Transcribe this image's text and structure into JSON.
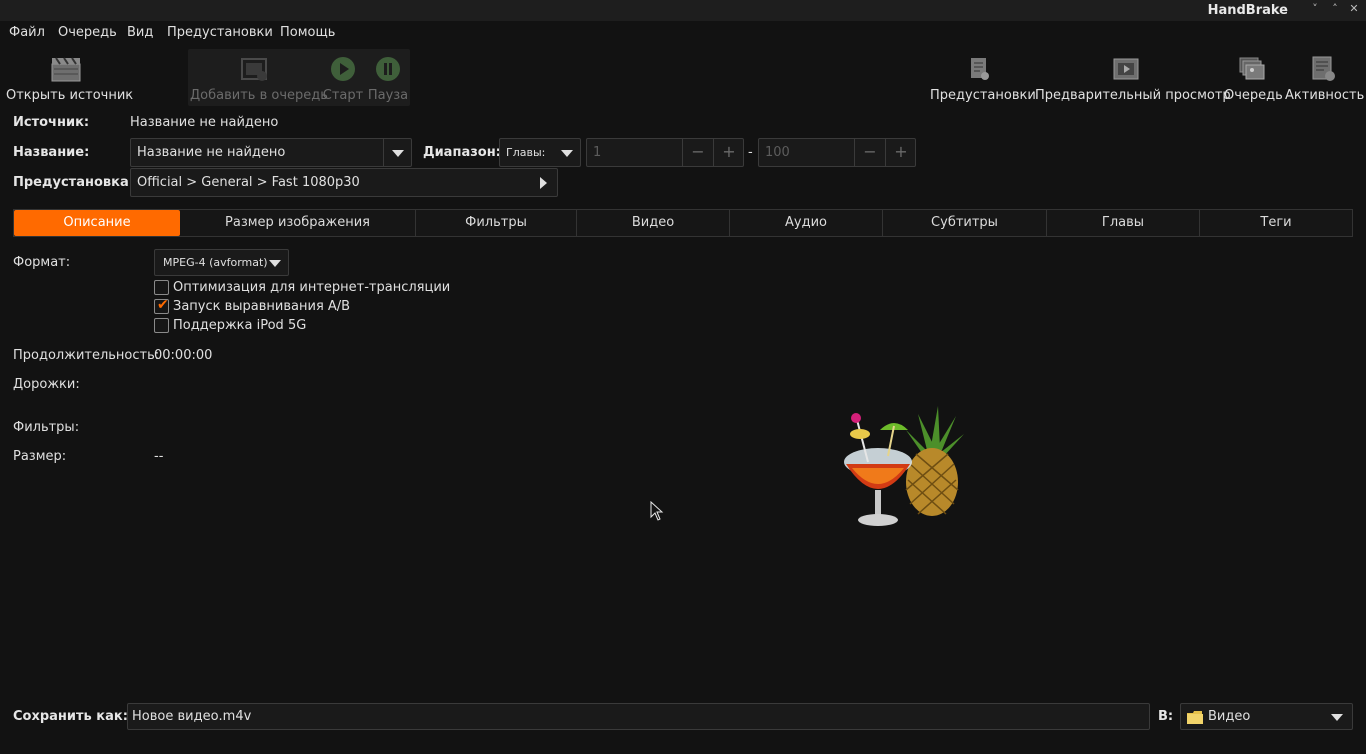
{
  "window": {
    "title": "HandBrake"
  },
  "menu": [
    "Файл",
    "Очередь",
    "Вид",
    "Предустановки",
    "Помощь"
  ],
  "toolbar": {
    "open_source": "Открыть источник",
    "add_to_queue": "Добавить в очередь",
    "start": "Старт",
    "pause": "Пауза",
    "presets": "Предустановки",
    "preview": "Предварительный просмотр",
    "queue": "Очередь",
    "activity": "Активность"
  },
  "source": {
    "label": "Источник:",
    "value": "Название не найдено"
  },
  "title_row": {
    "label": "Название:",
    "value": "Название не найдено"
  },
  "range": {
    "label": "Диапазон:",
    "type": "Главы:",
    "from": "1",
    "dash": "-",
    "to": "100",
    "minus": "−",
    "plus": "+"
  },
  "preset": {
    "label": "Предустановка:",
    "value": "Official > General > Fast 1080p30"
  },
  "tabs": [
    "Описание",
    "Размер изображения",
    "Фильтры",
    "Видео",
    "Аудио",
    "Субтитры",
    "Главы",
    "Теги"
  ],
  "active_tab": "Описание",
  "summary": {
    "format_label": "Формат:",
    "format_value": "MPEG-4 (avformat)",
    "options": [
      {
        "label": "Оптимизация для интернет-трансляции",
        "checked": false
      },
      {
        "label": "Запуск выравнивания A/B",
        "checked": true
      },
      {
        "label": "Поддержка iPod 5G",
        "checked": false
      }
    ],
    "duration_label": "Продолжительность:",
    "duration_value": "00:00:00",
    "tracks_label": "Дорожки:",
    "filters_label": "Фильтры:",
    "size_label": "Размер:",
    "size_value": "--"
  },
  "save": {
    "label": "Сохранить как:",
    "value": "Новое видео.m4v",
    "to_label": "В:",
    "folder": "Видео"
  },
  "colors": {
    "accent": "#ff6a00",
    "background": "#121212"
  }
}
